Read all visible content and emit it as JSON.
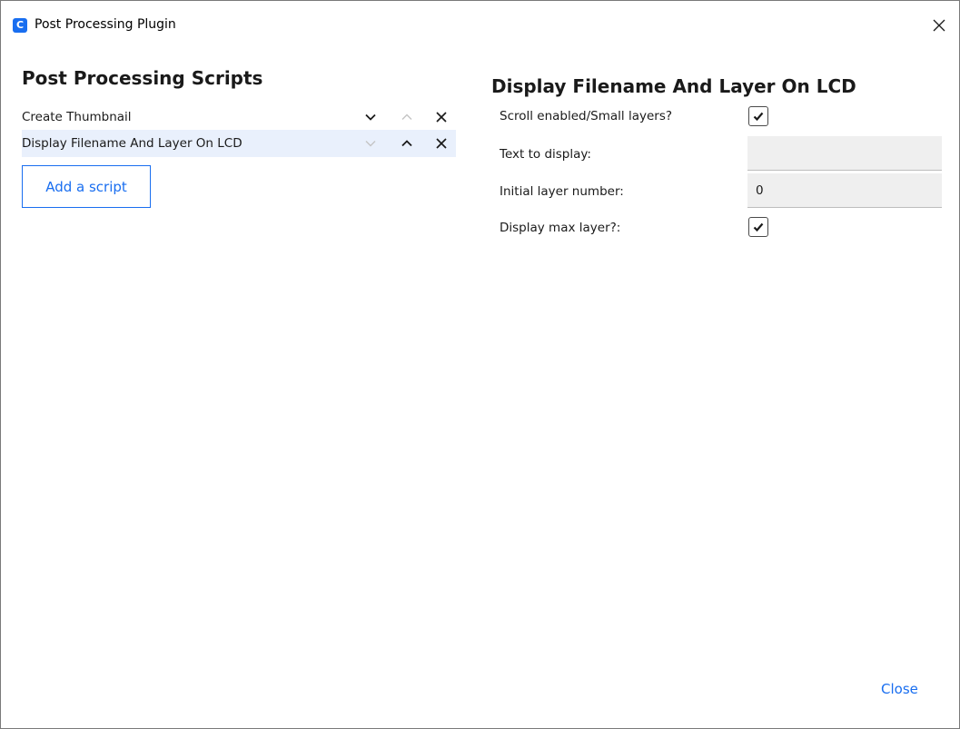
{
  "window": {
    "title": "Post Processing Plugin",
    "app_icon_glyph": "C",
    "icons": {
      "app": "cura-app-icon",
      "close": "close-icon"
    }
  },
  "scripts_panel": {
    "heading": "Post Processing Scripts",
    "scripts": [
      {
        "name": "Create Thumbnail",
        "selected": false,
        "move_down_enabled": true,
        "move_up_enabled": false
      },
      {
        "name": "Display Filename And Layer On LCD",
        "selected": true,
        "move_down_enabled": false,
        "move_up_enabled": true
      }
    ],
    "add_button_label": "Add a script",
    "icons": {
      "move_down": "chevron-down-icon",
      "move_up": "chevron-up-icon",
      "remove": "close-icon"
    }
  },
  "settings_panel": {
    "heading": "Display Filename And Layer On LCD",
    "settings": [
      {
        "label": "Scroll enabled/Small layers?",
        "type": "checkbox",
        "checked": true
      },
      {
        "label": "Text to display:",
        "type": "text",
        "value": ""
      },
      {
        "label": "Initial layer number:",
        "type": "text",
        "value": "0"
      },
      {
        "label": "Display max layer?:",
        "type": "checkbox",
        "checked": true
      }
    ]
  },
  "footer": {
    "close_label": "Close"
  },
  "colors": {
    "accent": "#196ef0",
    "selected_row": "#e9f0fc",
    "field_bg": "#efefef",
    "icon_enabled": "#1a1a1a",
    "icon_disabled": "#c4c4c4"
  }
}
